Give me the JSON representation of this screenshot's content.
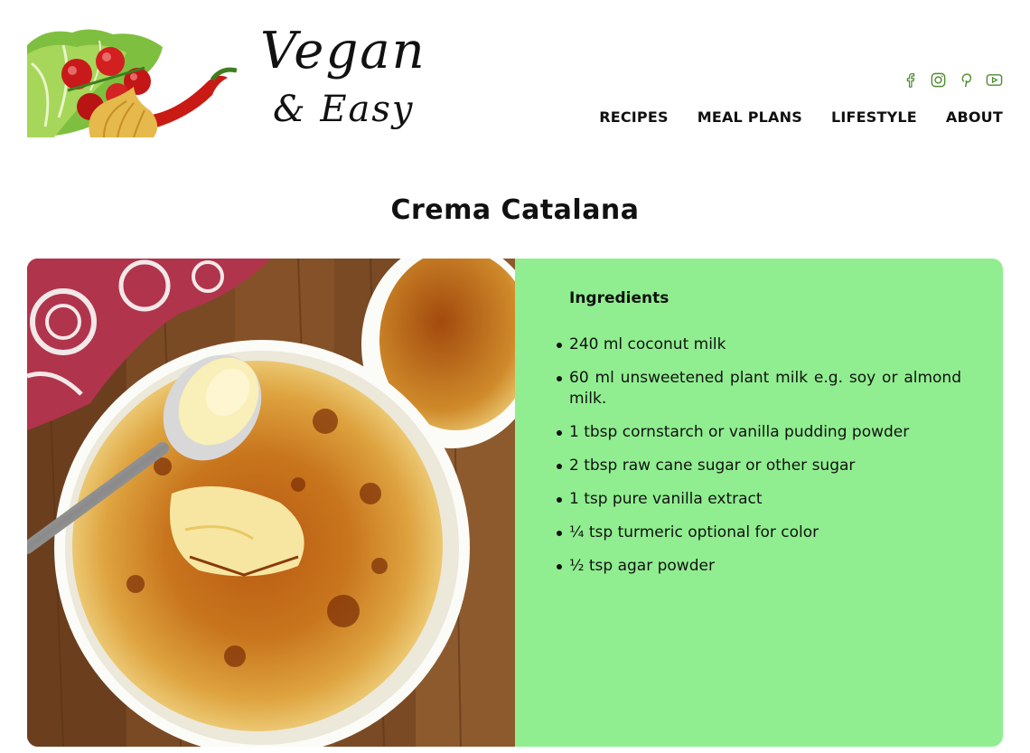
{
  "header": {
    "logo_line1": "Vegan",
    "logo_line2": "& Easy",
    "social": [
      {
        "icon": "facebook-icon"
      },
      {
        "icon": "instagram-icon"
      },
      {
        "icon": "pinterest-icon"
      },
      {
        "icon": "youtube-icon"
      }
    ],
    "nav": [
      {
        "label": "RECIPES"
      },
      {
        "label": "MEAL PLANS"
      },
      {
        "label": "LIFESTYLE"
      },
      {
        "label": "ABOUT"
      }
    ]
  },
  "recipe": {
    "title": "Crema Catalana",
    "ingredients_heading": "Ingredients",
    "ingredients": [
      "240 ml coconut milk",
      "60 ml unsweetened plant milk e.g. soy or almond milk.",
      "1 tbsp cornstarch or vanilla pudding powder",
      "2 tbsp raw cane sugar or other sugar",
      "1 tsp pure vanilla extract",
      "¼ tsp turmeric optional for color",
      "½ tsp agar powder"
    ]
  },
  "colors": {
    "ingredients_bg": "#90ee90",
    "social_icon": "#4f8a2f",
    "text": "#111111"
  }
}
